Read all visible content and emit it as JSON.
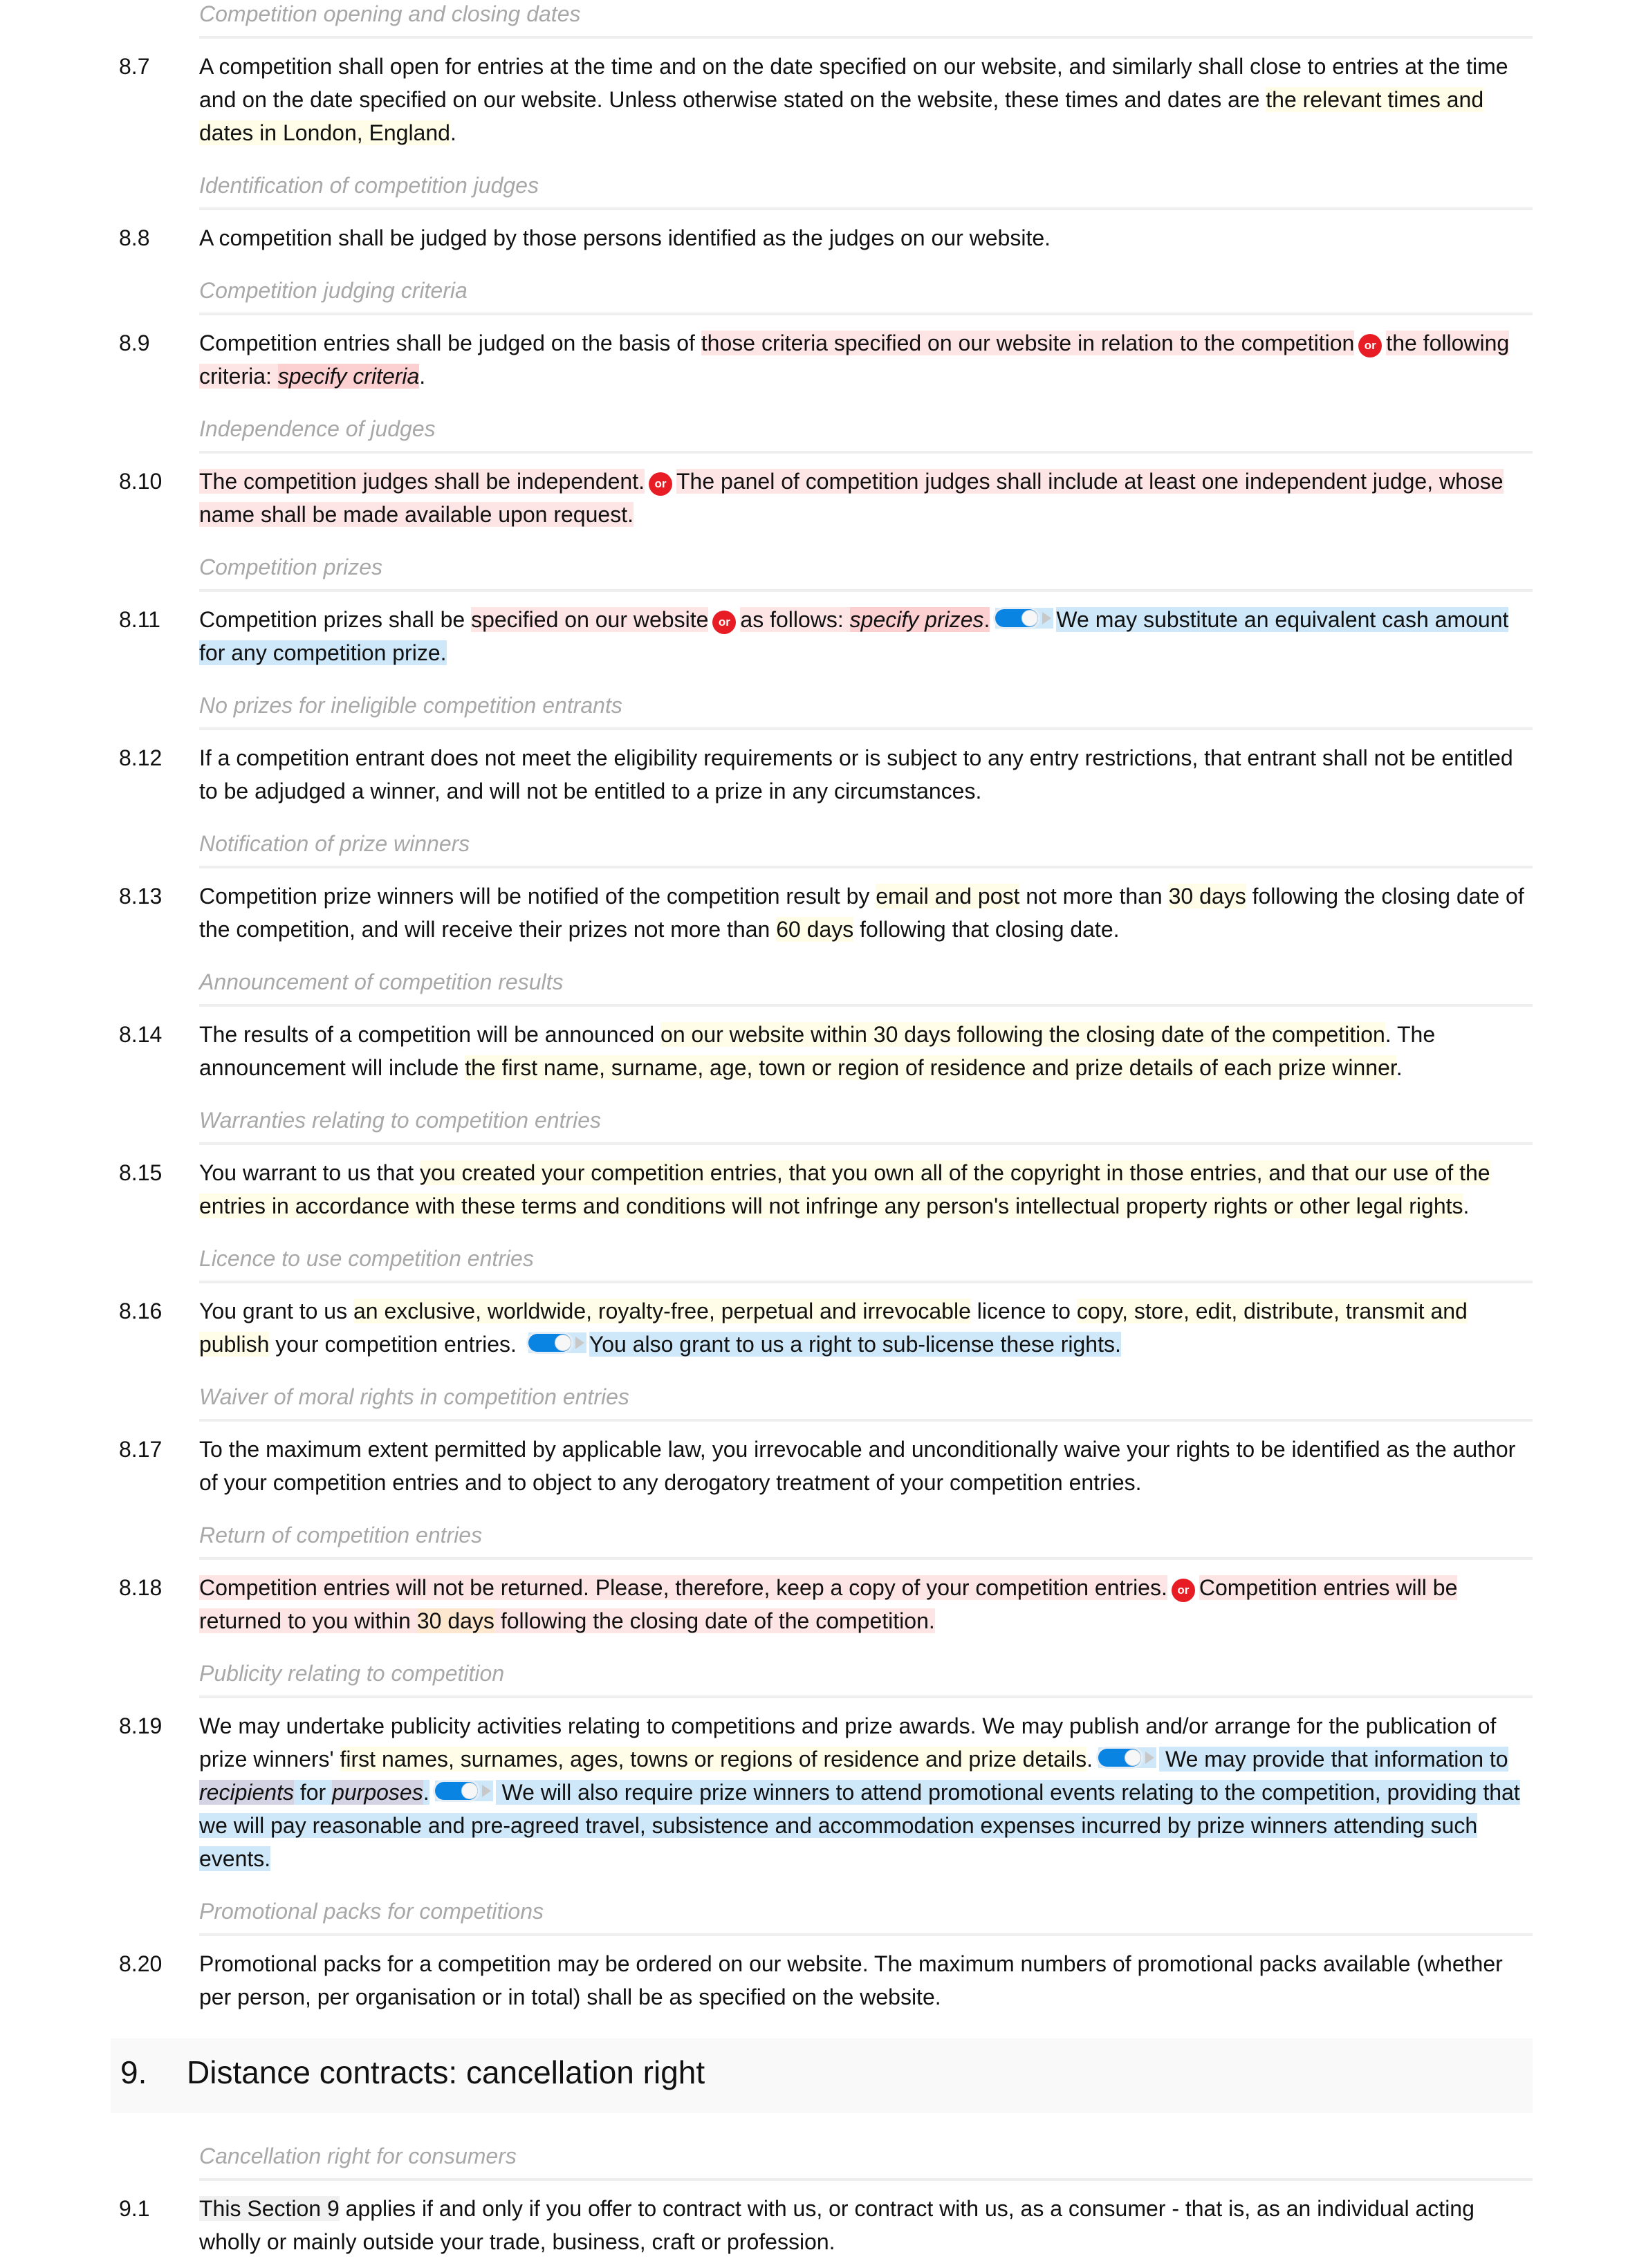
{
  "document": {
    "clauses": [
      {
        "heading": "Competition opening and closing dates",
        "number": "8.7",
        "segments": [
          {
            "t": "A competition shall open for entries at the time and on the date specified on our website, and similarly shall close to entries at the time and on the date specified on our website. Unless otherwise stated on the website, these times and dates are ",
            "s": ""
          },
          {
            "t": "the relevant times and dates in London, England",
            "s": "yellow"
          },
          {
            "t": ".",
            "s": ""
          }
        ]
      },
      {
        "heading": "Identification of competition judges",
        "number": "8.8",
        "segments": [
          {
            "t": "A competition shall be judged by those persons identified as the judges on our website.",
            "s": ""
          }
        ]
      },
      {
        "heading": "Competition judging criteria",
        "number": "8.9",
        "segments": [
          {
            "t": "Competition entries shall be judged on the basis of ",
            "s": ""
          },
          {
            "t": "those criteria specified on our website in relation to the competition",
            "s": "red"
          },
          {
            "t": "or",
            "s": "or"
          },
          {
            "t": "the following criteria: ",
            "s": "red"
          },
          {
            "t": "specify criteria",
            "s": "red-dark-italic"
          },
          {
            "t": ".",
            "s": ""
          }
        ]
      },
      {
        "heading": "Independence of judges",
        "number": "8.10",
        "segments": [
          {
            "t": "The competition judges shall be independent.",
            "s": "red"
          },
          {
            "t": "or",
            "s": "or"
          },
          {
            "t": "The panel of competition judges shall include at least one independent judge, whose name shall be made available upon request.",
            "s": "red"
          }
        ]
      },
      {
        "heading": "Competition prizes",
        "number": "8.11",
        "segments": [
          {
            "t": "Competition prizes shall be ",
            "s": ""
          },
          {
            "t": "specified on our website",
            "s": "red"
          },
          {
            "t": "or",
            "s": "or"
          },
          {
            "t": "as follows: ",
            "s": "red"
          },
          {
            "t": "specify prizes",
            "s": "red-dark-italic"
          },
          {
            "t": ".",
            "s": "red-dark"
          },
          {
            "t": "toggle",
            "s": "toggle"
          },
          {
            "t": "We may substitute an equivalent cash amount for any competition prize.",
            "s": "blue"
          }
        ]
      },
      {
        "heading": "No prizes for ineligible competition entrants",
        "number": "8.12",
        "segments": [
          {
            "t": "If a competition entrant does not meet the eligibility requirements or is subject to any entry restrictions, that entrant shall not be entitled to be adjudged a winner, and will not be entitled to a prize in any circumstances.",
            "s": ""
          }
        ]
      },
      {
        "heading": "Notification of prize winners",
        "number": "8.13",
        "segments": [
          {
            "t": "Competition prize winners will be notified of the competition result by ",
            "s": ""
          },
          {
            "t": "email and post",
            "s": "yellow"
          },
          {
            "t": " not more than ",
            "s": ""
          },
          {
            "t": "30 days",
            "s": "yellow"
          },
          {
            "t": " following the closing date of the competition, and will receive their prizes not more than ",
            "s": ""
          },
          {
            "t": "60 days",
            "s": "yellow"
          },
          {
            "t": " following that closing date.",
            "s": ""
          }
        ]
      },
      {
        "heading": "Announcement of competition results",
        "number": "8.14",
        "segments": [
          {
            "t": "The results of a competition will be announced ",
            "s": ""
          },
          {
            "t": "on our website within 30 days following the closing date of the competition",
            "s": "yellow"
          },
          {
            "t": ". The announcement will include ",
            "s": ""
          },
          {
            "t": "the first name, surname, age, town or region of residence and prize details of each prize winner",
            "s": "yellow"
          },
          {
            "t": ".",
            "s": ""
          }
        ]
      },
      {
        "heading": "Warranties relating to competition entries",
        "number": "8.15",
        "segments": [
          {
            "t": "You warrant to us that ",
            "s": ""
          },
          {
            "t": "you created your competition entries, that you own all of the copyright in those entries, and that our use of the entries in accordance with these terms and conditions will not infringe any person's intellectual property rights or other legal rights",
            "s": "yellow"
          },
          {
            "t": ".",
            "s": ""
          }
        ]
      },
      {
        "heading": "Licence to use competition entries",
        "number": "8.16",
        "segments": [
          {
            "t": "You grant to us ",
            "s": ""
          },
          {
            "t": "an exclusive, worldwide, royalty-free, perpetual and irrevocable",
            "s": "yellow"
          },
          {
            "t": " licence to ",
            "s": ""
          },
          {
            "t": "copy, store, edit, distribute, transmit and publish",
            "s": "yellow"
          },
          {
            "t": " your competition entries. ",
            "s": ""
          },
          {
            "t": "toggle",
            "s": "toggle"
          },
          {
            "t": "You also grant to us a right to sub-license these rights.",
            "s": "blue"
          }
        ]
      },
      {
        "heading": "Waiver of moral rights in competition entries",
        "number": "8.17",
        "segments": [
          {
            "t": "To the maximum extent permitted by applicable law, you irrevocable and unconditionally waive your rights to be identified as the author of your competition entries and to object to any derogatory treatment of your competition entries.",
            "s": ""
          }
        ]
      },
      {
        "heading": "Return of competition entries",
        "number": "8.18",
        "segments": [
          {
            "t": "Competition entries will not be returned. Please, therefore, keep a copy of your competition entries.",
            "s": "red"
          },
          {
            "t": "or",
            "s": "or"
          },
          {
            "t": "Competition entries will be returned to you within ",
            "s": "red"
          },
          {
            "t": "30 days",
            "s": "orange"
          },
          {
            "t": " following the closing date of the competition.",
            "s": "red"
          }
        ]
      },
      {
        "heading": "Publicity relating to competition",
        "number": "8.19",
        "segments": [
          {
            "t": "We may undertake publicity activities relating to competitions and prize awards. We may publish and/or arrange for the publication of prize winners' ",
            "s": ""
          },
          {
            "t": "first names, surnames, ages, towns or regions of residence and prize details",
            "s": "yellow"
          },
          {
            "t": ".",
            "s": ""
          },
          {
            "t": "toggle",
            "s": "toggle"
          },
          {
            "t": " We may provide that information to ",
            "s": "blue"
          },
          {
            "t": "recipients",
            "s": "grey-italic"
          },
          {
            "t": " for ",
            "s": "blue"
          },
          {
            "t": "purposes",
            "s": "grey-italic"
          },
          {
            "t": ".",
            "s": "blue"
          },
          {
            "t": "toggle",
            "s": "toggle"
          },
          {
            "t": " We will also require prize winners to attend promotional events relating to the competition, providing that we will pay reasonable and pre-agreed travel, subsistence and accommodation expenses incurred by prize winners attending such events.",
            "s": "blue"
          }
        ]
      },
      {
        "heading": "Promotional packs for competitions",
        "number": "8.20",
        "segments": [
          {
            "t": "Promotional packs for a competition may be ordered on our website. The maximum numbers of promotional packs available (whether per person, per organisation or in total) shall be as specified on the website.",
            "s": ""
          }
        ]
      }
    ],
    "section": {
      "number": "9.",
      "title": "Distance contracts: cancellation right"
    },
    "section_clauses": [
      {
        "heading": "Cancellation right for consumers",
        "number": "9.1",
        "segments": [
          {
            "t": "This Section 9",
            "s": "light-grey"
          },
          {
            "t": " applies if and only if you offer to contract with us, or contract with us, as a consumer - that is, as an individual acting wholly or mainly outside your trade, business, craft or profession.",
            "s": ""
          }
        ]
      }
    ],
    "icons": {
      "or_badge": "or-choice-icon",
      "toggle": "toggle-switch-icon"
    },
    "colors": {
      "optional_blue": "#cfe8f9",
      "alternative_red": "#fde5e6",
      "placeholder_red": "#fccfd1",
      "variable_yellow": "#fffde7",
      "or_badge": "#e81c24",
      "toggle_blue": "#0a84e3",
      "subheading_grey": "#a8a8a8"
    }
  }
}
